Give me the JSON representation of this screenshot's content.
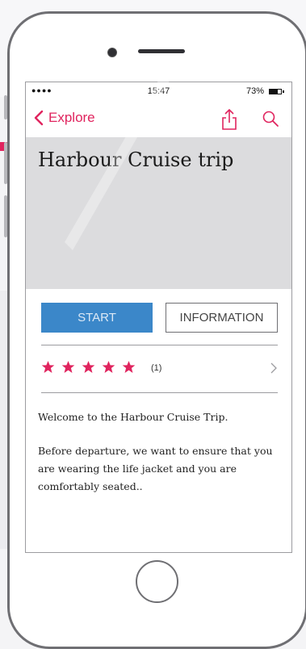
{
  "status_bar": {
    "signal": "●●●●",
    "time": "15:47",
    "battery": "73%"
  },
  "nav": {
    "back_label": "Explore",
    "share_icon": "share-icon",
    "search_icon": "search-icon"
  },
  "hero": {
    "title": "Harbour Cruise trip"
  },
  "actions": {
    "start_label": "START",
    "info_label": "INFORMATION"
  },
  "rating": {
    "stars": 5,
    "count_label": "(1)"
  },
  "description": {
    "paragraph_1": "Welcome to the Harbour Cruise Trip.",
    "paragraph_2": "Before departure, we want to ensure that you are wearing the life jacket and you are comfortably seated.."
  },
  "colors": {
    "accent": "#e0245e",
    "primary_button": "#3b87c9",
    "hero_bg": "#dcdcde"
  }
}
